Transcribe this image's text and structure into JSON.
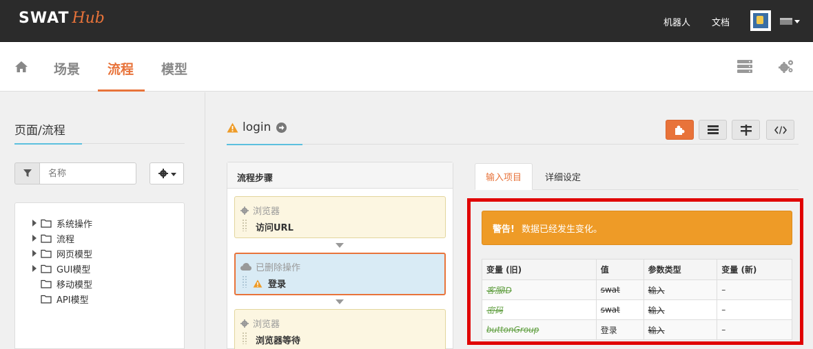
{
  "topbar": {
    "brand_main": "SWAT",
    "brand_sub": "Hub",
    "links": [
      "机器人",
      "文档"
    ]
  },
  "subnav": {
    "tabs": [
      {
        "label": "场景",
        "active": false
      },
      {
        "label": "流程",
        "active": true
      },
      {
        "label": "模型",
        "active": false
      }
    ]
  },
  "left": {
    "title": "页面/流程",
    "search_placeholder": "名称",
    "tree": [
      {
        "label": "系统操作",
        "expandable": true
      },
      {
        "label": "流程",
        "expandable": true
      },
      {
        "label": "网页模型",
        "expandable": true
      },
      {
        "label": "GUI模型",
        "expandable": true
      },
      {
        "label": "移动模型",
        "expandable": false
      },
      {
        "label": "API模型",
        "expandable": false
      }
    ]
  },
  "main": {
    "title": "login",
    "steps_title": "流程步骤",
    "steps": [
      {
        "type": "浏览器",
        "name": "访问URL",
        "status": "normal"
      },
      {
        "type": "已删除操作",
        "name": "登录",
        "status": "deleted"
      },
      {
        "type": "浏览器",
        "name": "浏览器等待",
        "status": "normal"
      }
    ],
    "tabs": [
      "输入项目",
      "详细设定"
    ],
    "alert": {
      "strong": "警告!",
      "text": "数据已经发生变化。"
    },
    "table": {
      "headers": [
        "变量 (旧)",
        "值",
        "参数类型",
        "变量 (新)"
      ],
      "rows": [
        [
          "客服ID",
          "swat",
          "输入",
          "–"
        ],
        [
          "密码",
          "swat",
          "输入",
          "–"
        ],
        [
          "buttonGroup",
          "登录",
          "输入",
          "–"
        ]
      ]
    }
  },
  "colors": {
    "accent": "#e8733a",
    "warning": "#ee9b27",
    "highlight_frame": "#e00000",
    "old_var": "#5f9e3f"
  }
}
